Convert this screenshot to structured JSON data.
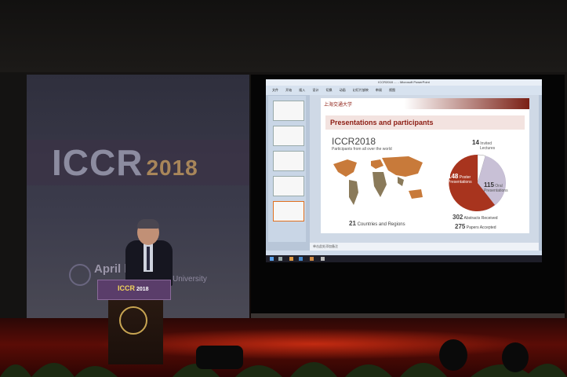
{
  "banner": {
    "title": "ICCR",
    "year": "2018",
    "subtitle": "April                 hanghai",
    "subtitle2": "University"
  },
  "screen": {
    "window_title": "ICCR2018 .... - Microsoft PowerPoint",
    "menu_items": [
      "文件",
      "开始",
      "插入",
      "设计",
      "切换",
      "动画",
      "幻灯片放映",
      "审阅",
      "视图"
    ],
    "notes_text": "单击此处添加备注",
    "slide": {
      "logo_text": "上海交通大学",
      "header": "Presentations and participants",
      "event": "ICCR2018",
      "tagline": "Participants from all over the world",
      "countries": {
        "value": "21",
        "label": "Countries and Regions"
      },
      "invited": {
        "value": "14",
        "label1": "Invited",
        "label2": "Lectures"
      },
      "oral": {
        "value": "115",
        "label1": "Oral",
        "label2": "Presentations"
      },
      "poster": {
        "value": "148",
        "label1": "Poster",
        "label2": "Presentations"
      },
      "abstracts": {
        "value": "302",
        "label": "Abstracts Received"
      },
      "papers": {
        "value": "275",
        "label": "Papers Accepted"
      }
    }
  },
  "podium": {
    "label": "ICCR",
    "year": "2018"
  },
  "colors": {
    "accent_red": "#8c1c12",
    "map_orange": "#c87a3a",
    "pie_gray": "#b8b0c8",
    "stage_red": "#5a0c06"
  }
}
